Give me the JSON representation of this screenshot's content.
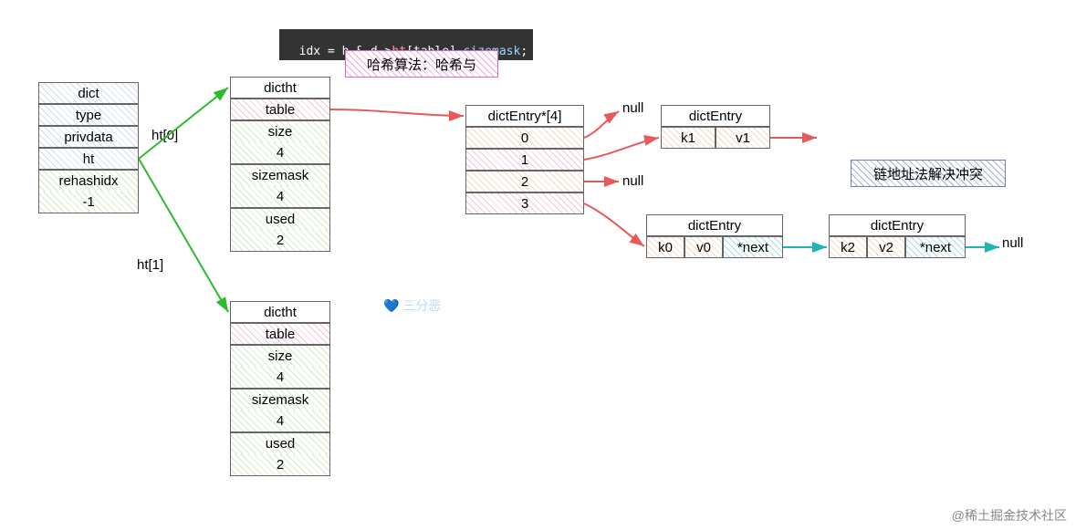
{
  "code_line": "idx = h & d->ht[table].sizemask;",
  "callout_hash": "哈希算法：哈希与",
  "callout_chain": "链地址法解决冲突",
  "dict": {
    "title": "dict",
    "fields": [
      "type",
      "privdata",
      "ht",
      "rehashidx",
      "-1"
    ]
  },
  "ht_labels": {
    "ht0": "ht[0]",
    "ht1": "ht[1]"
  },
  "dictht": {
    "title": "dictht",
    "table": "table",
    "size_label": "size",
    "size_val": "4",
    "sizemask_label": "sizemask",
    "sizemask_val": "4",
    "used_label": "used",
    "used_val": "2"
  },
  "entry_array": {
    "title": "dictEntry*[4]",
    "slots": [
      "0",
      "1",
      "2",
      "3"
    ]
  },
  "nulls": {
    "n0": "null",
    "n2": "null",
    "n_end": "null"
  },
  "entries": {
    "title": "dictEntry",
    "e1": {
      "k": "k1",
      "v": "v1"
    },
    "e0": {
      "k": "k0",
      "v": "v0",
      "next": "*next"
    },
    "e2": {
      "k": "k2",
      "v": "v2",
      "next": "*next"
    }
  },
  "watermarks": {
    "center": "三分恶",
    "corner": "@稀土掘金技术社区"
  }
}
